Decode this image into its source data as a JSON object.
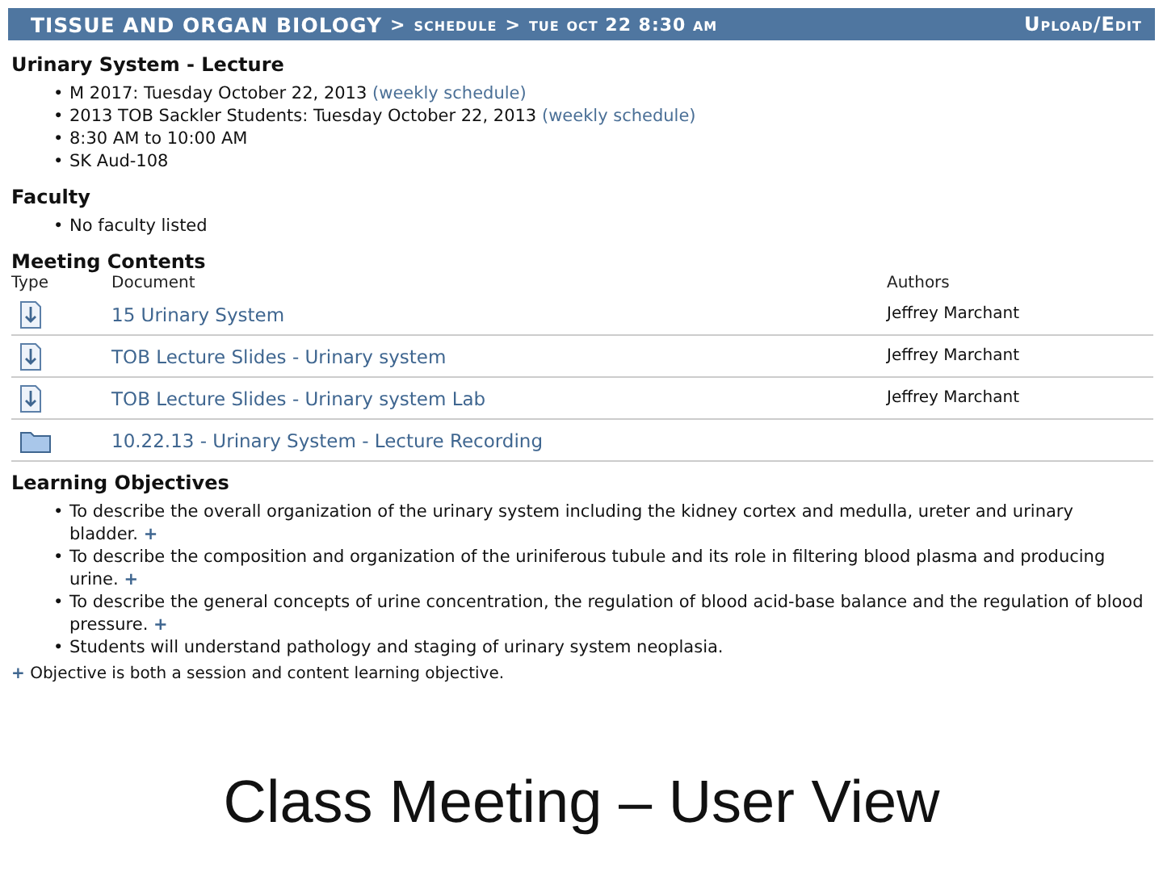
{
  "header": {
    "course": "TISSUE AND ORGAN BIOLOGY",
    "crumbs": [
      {
        "sep": ">",
        "label": "schedule"
      },
      {
        "sep": ">",
        "label": "tue oct 22 8:30 am"
      }
    ],
    "action": "Upload/Edit"
  },
  "session": {
    "title": "Urinary System - Lecture",
    "details": [
      {
        "bullet": "•",
        "text": "M 2017: Tuesday October 22, 2013",
        "link": "(weekly schedule)"
      },
      {
        "bullet": "•",
        "text": "2013 TOB Sackler Students: Tuesday October 22, 2013",
        "link": "(weekly schedule)"
      },
      {
        "bullet": "•",
        "text": "8:30 AM to 10:00 AM"
      },
      {
        "bullet": "•",
        "text": "SK Aud-108"
      }
    ]
  },
  "faculty": {
    "title": "Faculty",
    "items": [
      {
        "bullet": "•",
        "text": "No faculty listed"
      }
    ]
  },
  "contents": {
    "title": "Meeting Contents",
    "columns": [
      "Type",
      "Document",
      "Authors"
    ],
    "rows": [
      {
        "kind": "file",
        "document": "15 Urinary System",
        "author": "Jeffrey Marchant"
      },
      {
        "kind": "file",
        "document": "TOB Lecture Slides - Urinary system",
        "author": "Jeffrey Marchant"
      },
      {
        "kind": "file",
        "document": "TOB Lecture Slides - Urinary system Lab",
        "author": "Jeffrey Marchant"
      },
      {
        "kind": "folder",
        "document": "10.22.13 - Urinary System - Lecture Recording"
      }
    ]
  },
  "objectives": {
    "title": "Learning Objectives",
    "items": [
      {
        "bullet": "•",
        "text": "To describe the overall organization of the urinary system including the kidney cortex and medulla, ureter and urinary bladder.",
        "marker": "+"
      },
      {
        "bullet": "•",
        "text": "To describe the composition and organization of the uriniferous tubule and its role in filtering blood plasma and producing urine.",
        "marker": "+"
      },
      {
        "bullet": "•",
        "text": "To describe the general concepts of urine concentration, the regulation of blood acid-base balance and the regulation of blood pressure.",
        "marker": "+"
      },
      {
        "bullet": "•",
        "text": "Students will understand pathology and staging of urinary system neoplasia."
      }
    ],
    "footnote": {
      "marker": "+",
      "text": "Objective is both a session and content learning objective."
    }
  },
  "caption": "Class Meeting – User View"
}
